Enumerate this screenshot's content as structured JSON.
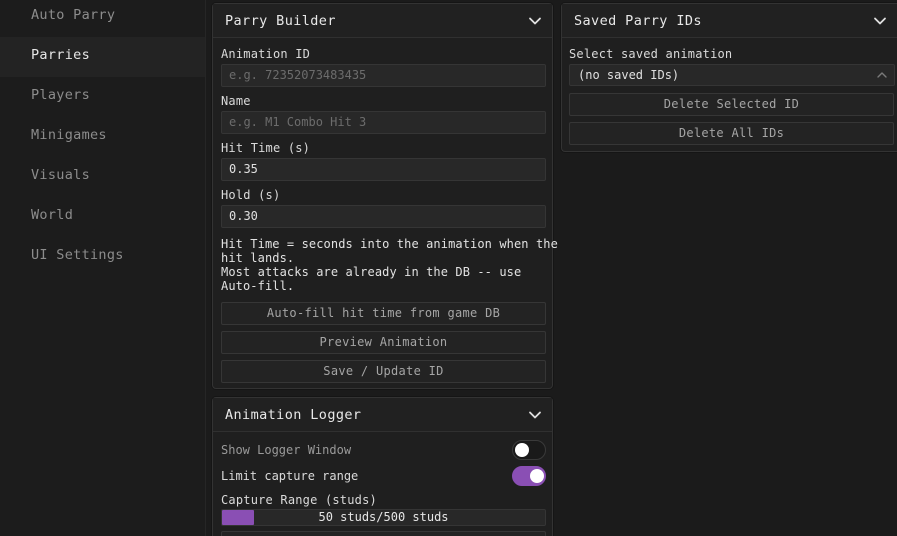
{
  "sidebar": {
    "items": [
      {
        "label": "Auto Parry"
      },
      {
        "label": "Parries"
      },
      {
        "label": "Players"
      },
      {
        "label": "Minigames"
      },
      {
        "label": "Visuals"
      },
      {
        "label": "World"
      },
      {
        "label": "UI Settings"
      }
    ],
    "active": "Parries"
  },
  "parry_builder": {
    "title": "Parry Builder",
    "animation_id_label": "Animation ID",
    "animation_id_placeholder": "e.g. 72352073483435",
    "name_label": "Name",
    "name_placeholder": "e.g. M1 Combo Hit 3",
    "hit_time_label": "Hit Time (s)",
    "hit_time_value": "0.35",
    "hold_label": "Hold (s)",
    "hold_value": "0.30",
    "note": "Hit Time = seconds into the animation when the\nhit lands.\nMost attacks are already in the DB -- use\nAuto-fill.",
    "autofill_label": "Auto-fill hit time from game DB",
    "preview_label": "Preview Animation",
    "save_label": "Save / Update ID"
  },
  "saved_parry_ids": {
    "title": "Saved Parry IDs",
    "select_label": "Select saved animation",
    "selected_value": "(no saved IDs)",
    "delete_selected_label": "Delete Selected ID",
    "delete_all_label": "Delete All IDs"
  },
  "animation_logger": {
    "title": "Animation Logger",
    "show_logger_label": "Show Logger Window",
    "show_logger_on": false,
    "limit_capture_label": "Limit capture range",
    "limit_capture_on": true,
    "capture_range_label": "Capture Range (studs)",
    "capture_range_text": "50 studs/500 studs",
    "capture_range_fraction": 0.1
  },
  "colors": {
    "accent": "#8a4fb4",
    "background": "#1b1b1b",
    "panel": "#1f1f1f"
  }
}
